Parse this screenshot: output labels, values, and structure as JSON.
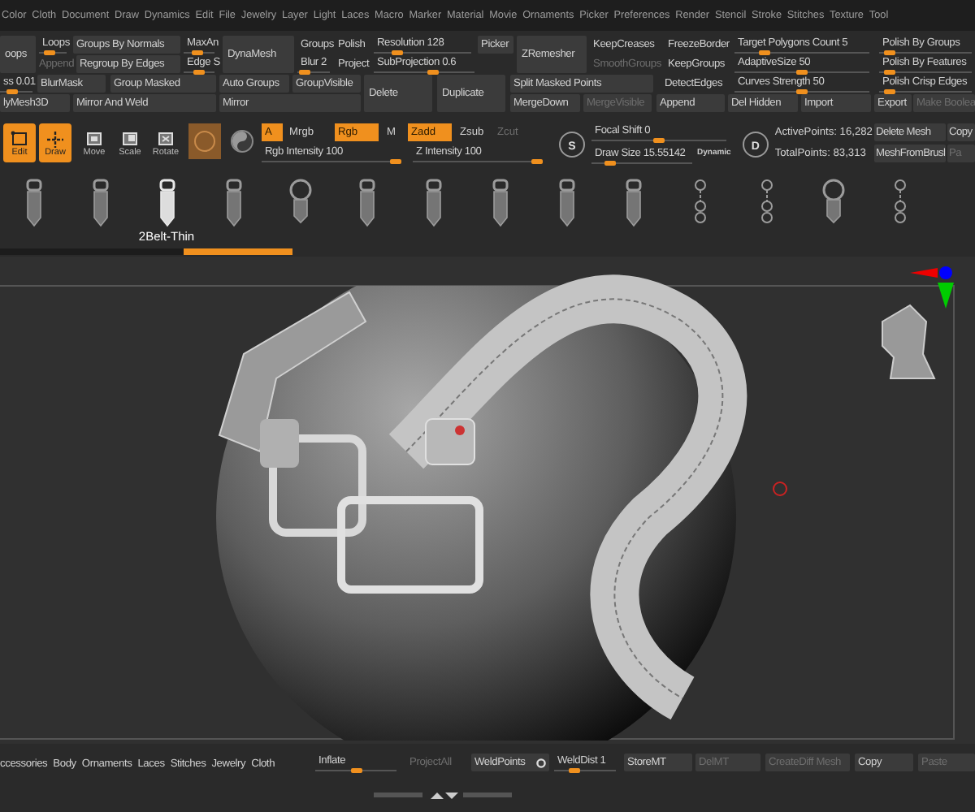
{
  "menu": [
    "Color",
    "Cloth",
    "Document",
    "Draw",
    "Dynamics",
    "Edit",
    "File",
    "Jewelry",
    "Layer",
    "Light",
    "Laces",
    "Macro",
    "Marker",
    "Material",
    "Movie",
    "Ornaments",
    "Picker",
    "Preferences",
    "Render",
    "Stencil",
    "Stroke",
    "Stitches",
    "Texture",
    "Tool"
  ],
  "palette": {
    "lines": [
      [
        {
          "kind": "tall",
          "label": "oops",
          "disabled": false
        },
        {
          "kind": "slider",
          "label": "Loops",
          "disabled": false,
          "level": 0.3
        },
        {
          "kind": "button",
          "label": "Groups By Normals",
          "disabled": false
        },
        {
          "kind": "slider",
          "label": "MaxAn",
          "disabled": false,
          "level": 0.4
        },
        {
          "kind": "tall",
          "label": "DynaMesh",
          "disabled": false
        },
        {
          "kind": "text",
          "label": "Groups",
          "disabled": false
        },
        {
          "kind": "text",
          "label": "Polish",
          "disabled": false
        },
        {
          "kind": "slider",
          "label": "Resolution 128",
          "disabled": false,
          "level": 0.2
        },
        {
          "kind": "button",
          "label": "Picker",
          "disabled": false
        },
        {
          "kind": "tall",
          "label": "ZRemesher",
          "disabled": false
        },
        {
          "kind": "text",
          "label": "KeepCreases",
          "disabled": false
        },
        {
          "kind": "text",
          "label": "FreezeBorder",
          "disabled": false
        },
        {
          "kind": "slider",
          "label": "Target Polygons Count 5",
          "disabled": false,
          "level": 0.2
        },
        {
          "kind": "slider",
          "label": "Polish By Groups",
          "disabled": false,
          "level": 0.05
        }
      ],
      [
        {
          "kind": "text",
          "label": "Append",
          "disabled": true
        },
        {
          "kind": "button",
          "label": "Regroup By Edges",
          "disabled": false
        },
        {
          "kind": "slider",
          "label": "Edge S",
          "disabled": false,
          "level": 0.5
        },
        {
          "kind": "slider",
          "label": "Blur 2",
          "disabled": false,
          "level": 0.1
        },
        {
          "kind": "text",
          "label": "Project",
          "disabled": false
        },
        {
          "kind": "slider",
          "label": "SubProjection 0.6",
          "disabled": false,
          "level": 0.6
        },
        {
          "kind": "text",
          "label": "SmoothGroups",
          "disabled": true
        },
        {
          "kind": "text",
          "label": "KeepGroups",
          "disabled": false
        },
        {
          "kind": "slider",
          "label": "AdaptiveSize 50",
          "disabled": false,
          "level": 0.5
        },
        {
          "kind": "slider",
          "label": "Polish By Features",
          "disabled": false,
          "level": 0.05
        }
      ],
      [
        {
          "kind": "slider",
          "label": "ss 0.01",
          "disabled": false,
          "level": 0.3
        },
        {
          "kind": "button",
          "label": "BlurMask",
          "disabled": false
        },
        {
          "kind": "button",
          "label": "Group Masked",
          "disabled": false
        },
        {
          "kind": "button",
          "label": "Auto Groups",
          "disabled": false
        },
        {
          "kind": "button",
          "label": "GroupVisible",
          "disabled": false
        },
        {
          "kind": "tall",
          "label": "Delete",
          "disabled": false
        },
        {
          "kind": "tall",
          "label": "Duplicate",
          "disabled": false
        },
        {
          "kind": "button",
          "label": "Split Masked Points",
          "disabled": false
        },
        {
          "kind": "text",
          "label": "DetectEdges",
          "disabled": false
        },
        {
          "kind": "slider",
          "label": "Curves Strength 50",
          "disabled": false,
          "level": 0.5
        },
        {
          "kind": "slider",
          "label": "Polish Crisp Edges",
          "disabled": false,
          "level": 0.05
        }
      ],
      [
        {
          "kind": "button",
          "label": "lyMesh3D",
          "disabled": false
        },
        {
          "kind": "button",
          "label": "Mirror And Weld",
          "disabled": false
        },
        {
          "kind": "button",
          "label": "Mirror",
          "disabled": false
        },
        {
          "kind": "button",
          "label": "MergeDown",
          "disabled": false
        },
        {
          "kind": "button",
          "label": "MergeVisible",
          "disabled": true
        },
        {
          "kind": "button",
          "label": "Append",
          "disabled": false
        },
        {
          "kind": "button",
          "label": "Del Hidden",
          "disabled": false
        },
        {
          "kind": "button",
          "label": "Import",
          "disabled": false
        },
        {
          "kind": "button",
          "label": "Export",
          "disabled": false
        },
        {
          "kind": "button",
          "label": "Make Boolea",
          "disabled": true
        }
      ]
    ]
  },
  "toolbar": {
    "modes": [
      {
        "kind": "edit",
        "label": "Edit",
        "selected": true
      },
      {
        "kind": "draw",
        "label": "Draw",
        "selected": true
      },
      {
        "kind": "move",
        "label": "Move",
        "selected": false
      },
      {
        "kind": "scale",
        "label": "Scale",
        "selected": false
      },
      {
        "kind": "rotate",
        "label": "Rotate",
        "selected": false
      }
    ],
    "toggles": [
      {
        "label": "A",
        "selected": true,
        "disabled": false
      },
      {
        "label": "Mrgb",
        "selected": false,
        "disabled": false
      },
      {
        "label": "Rgb",
        "selected": true,
        "disabled": false
      },
      {
        "label": "M",
        "selected": false,
        "disabled": false
      },
      {
        "label": "Zadd",
        "selected": true,
        "disabled": false
      },
      {
        "label": "Zsub",
        "selected": false,
        "disabled": false
      },
      {
        "label": "Zcut",
        "selected": false,
        "disabled": true
      }
    ],
    "intensity": [
      {
        "label": "Rgb Intensity 100",
        "level": 1.0
      },
      {
        "label": "Z Intensity 100",
        "level": 1.0
      }
    ],
    "focal_letter": "S",
    "stroke": [
      {
        "label": "Focal Shift 0",
        "level": 0.5
      },
      {
        "label": "Draw Size 15.55142",
        "level": 0.15
      }
    ],
    "dynamic": "Dynamic",
    "draw_letter": "D",
    "stats": [
      "ActivePoints: 16,282",
      "TotalPoints: 83,313"
    ],
    "mesh_buttons": [
      {
        "label": "Delete Mesh",
        "disabled": false
      },
      {
        "label": "Copy",
        "disabled": false
      },
      {
        "label": "MeshFromBrusl",
        "disabled": false
      },
      {
        "label": "Pa",
        "disabled": true
      }
    ]
  },
  "shelf": {
    "brushes": [
      {
        "kind": "strap",
        "selected": false
      },
      {
        "kind": "strap",
        "selected": false
      },
      {
        "kind": "strap",
        "selected": true,
        "label": "2Belt-Thin"
      },
      {
        "kind": "strap",
        "selected": false
      },
      {
        "kind": "ring",
        "selected": false
      },
      {
        "kind": "strap",
        "selected": false
      },
      {
        "kind": "strap",
        "selected": false
      },
      {
        "kind": "strap",
        "selected": false
      },
      {
        "kind": "strap",
        "selected": false
      },
      {
        "kind": "strap",
        "selected": false
      },
      {
        "kind": "chain",
        "selected": false
      },
      {
        "kind": "chain",
        "selected": false
      },
      {
        "kind": "ring",
        "selected": false
      },
      {
        "kind": "chain",
        "selected": false
      }
    ]
  },
  "bottom_bar": {
    "tabs": [
      "ccessories",
      "Body",
      "Ornaments",
      "Laces",
      "Stitches",
      "Jewelry",
      "Cloth"
    ],
    "controls": [
      {
        "kind": "slider",
        "label": "Inflate",
        "disabled": false,
        "level": 0.5
      },
      {
        "kind": "text",
        "label": "ProjectAll",
        "disabled": true
      },
      {
        "kind": "weld",
        "label": "WeldPoints",
        "disabled": false
      },
      {
        "kind": "slider",
        "label": "WeldDist 1",
        "disabled": false,
        "level": 0.3
      },
      {
        "kind": "button",
        "label": "StoreMT",
        "disabled": false
      },
      {
        "kind": "button",
        "label": "DelMT",
        "disabled": true
      },
      {
        "kind": "button",
        "label": "CreateDiff Mesh",
        "disabled": true
      },
      {
        "kind": "button",
        "label": "Copy",
        "disabled": false
      },
      {
        "kind": "button",
        "label": "Paste",
        "disabled": true
      }
    ]
  }
}
